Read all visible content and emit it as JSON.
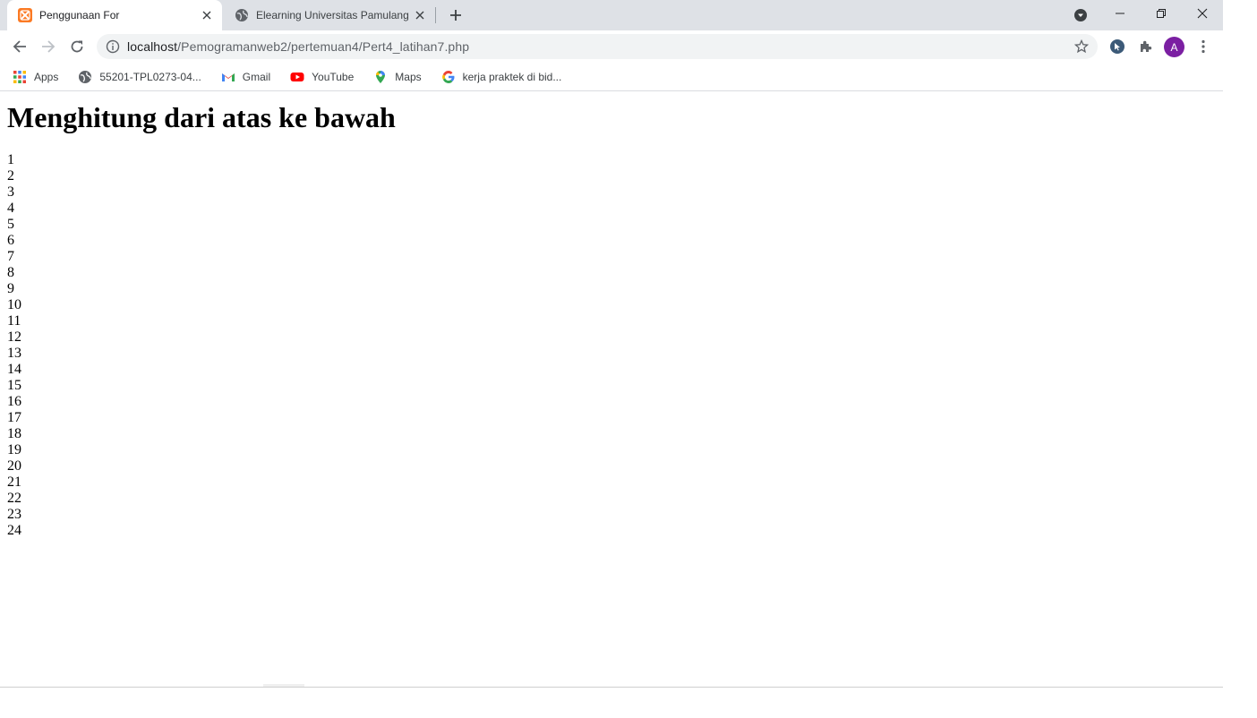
{
  "tabs": [
    {
      "title": "Penggunaan For",
      "active": true
    },
    {
      "title": "Elearning Universitas Pamulang",
      "active": false
    }
  ],
  "address": {
    "host": "localhost",
    "path": "/Pemogramanweb2/pertemuan4/Pert4_latihan7.php"
  },
  "profile": {
    "initial": "A",
    "color": "#7b1fa2"
  },
  "bookmarks": [
    {
      "label": "Apps",
      "icon": "apps-grid-icon"
    },
    {
      "label": "55201-TPL0273-04...",
      "icon": "globe-icon"
    },
    {
      "label": "Gmail",
      "icon": "gmail-icon"
    },
    {
      "label": "YouTube",
      "icon": "youtube-icon"
    },
    {
      "label": "Maps",
      "icon": "maps-pin-icon"
    },
    {
      "label": "kerja praktek di bid...",
      "icon": "google-icon"
    }
  ],
  "page": {
    "heading": "Menghitung dari atas ke bawah",
    "numbers": [
      "1",
      "2",
      "3",
      "4",
      "5",
      "6",
      "7",
      "8",
      "9",
      "10",
      "11",
      "12",
      "13",
      "14",
      "15",
      "16",
      "17",
      "18",
      "19",
      "20",
      "21",
      "22",
      "23",
      "24"
    ]
  }
}
